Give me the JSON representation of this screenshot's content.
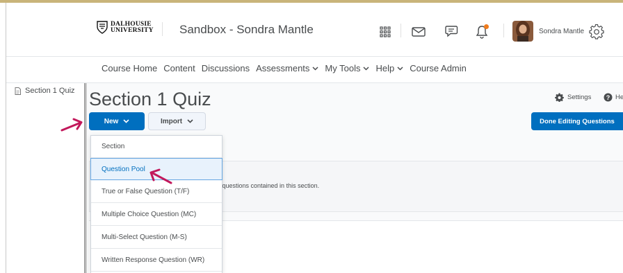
{
  "header": {
    "logo_line1": "DALHOUSIE",
    "logo_line2": "UNIVERSITY",
    "course_title": "Sandbox - Sondra Mantle",
    "user_name": "Sondra Mantle"
  },
  "icons": {
    "waffle": "grid-icon",
    "mail": "mail-icon",
    "chat": "chat-icon",
    "bell": "bell-icon",
    "settings": "gear-icon"
  },
  "nav": {
    "items": [
      {
        "label": "Course Home",
        "dropdown": false
      },
      {
        "label": "Content",
        "dropdown": false
      },
      {
        "label": "Discussions",
        "dropdown": false
      },
      {
        "label": "Assessments",
        "dropdown": true
      },
      {
        "label": "My Tools",
        "dropdown": true
      },
      {
        "label": "Help",
        "dropdown": true
      },
      {
        "label": "Course Admin",
        "dropdown": false
      }
    ]
  },
  "tree": {
    "item_label": "Section 1 Quiz"
  },
  "main": {
    "title": "Section 1 Quiz",
    "settings_label": "Settings",
    "help_label": "He",
    "new_label": "New",
    "import_label": "Import",
    "done_label": "Done Editing Questions",
    "panel_text": "r questions contained in this section."
  },
  "dropdown": {
    "items": [
      {
        "label": "Section",
        "active": false
      },
      {
        "label": "Question Pool",
        "active": true
      },
      {
        "label": "True or False Question (T/F)",
        "active": false
      },
      {
        "label": "Multiple Choice Question (MC)",
        "active": false
      },
      {
        "label": "Multi-Select Question (M-S)",
        "active": false
      },
      {
        "label": "Written Response Question (WR)",
        "active": false
      }
    ]
  },
  "colors": {
    "primary": "#006fbf",
    "annotation_arrow": "#c2185b",
    "notification": "#f07c1e",
    "top_accent": "#c9b47a"
  }
}
